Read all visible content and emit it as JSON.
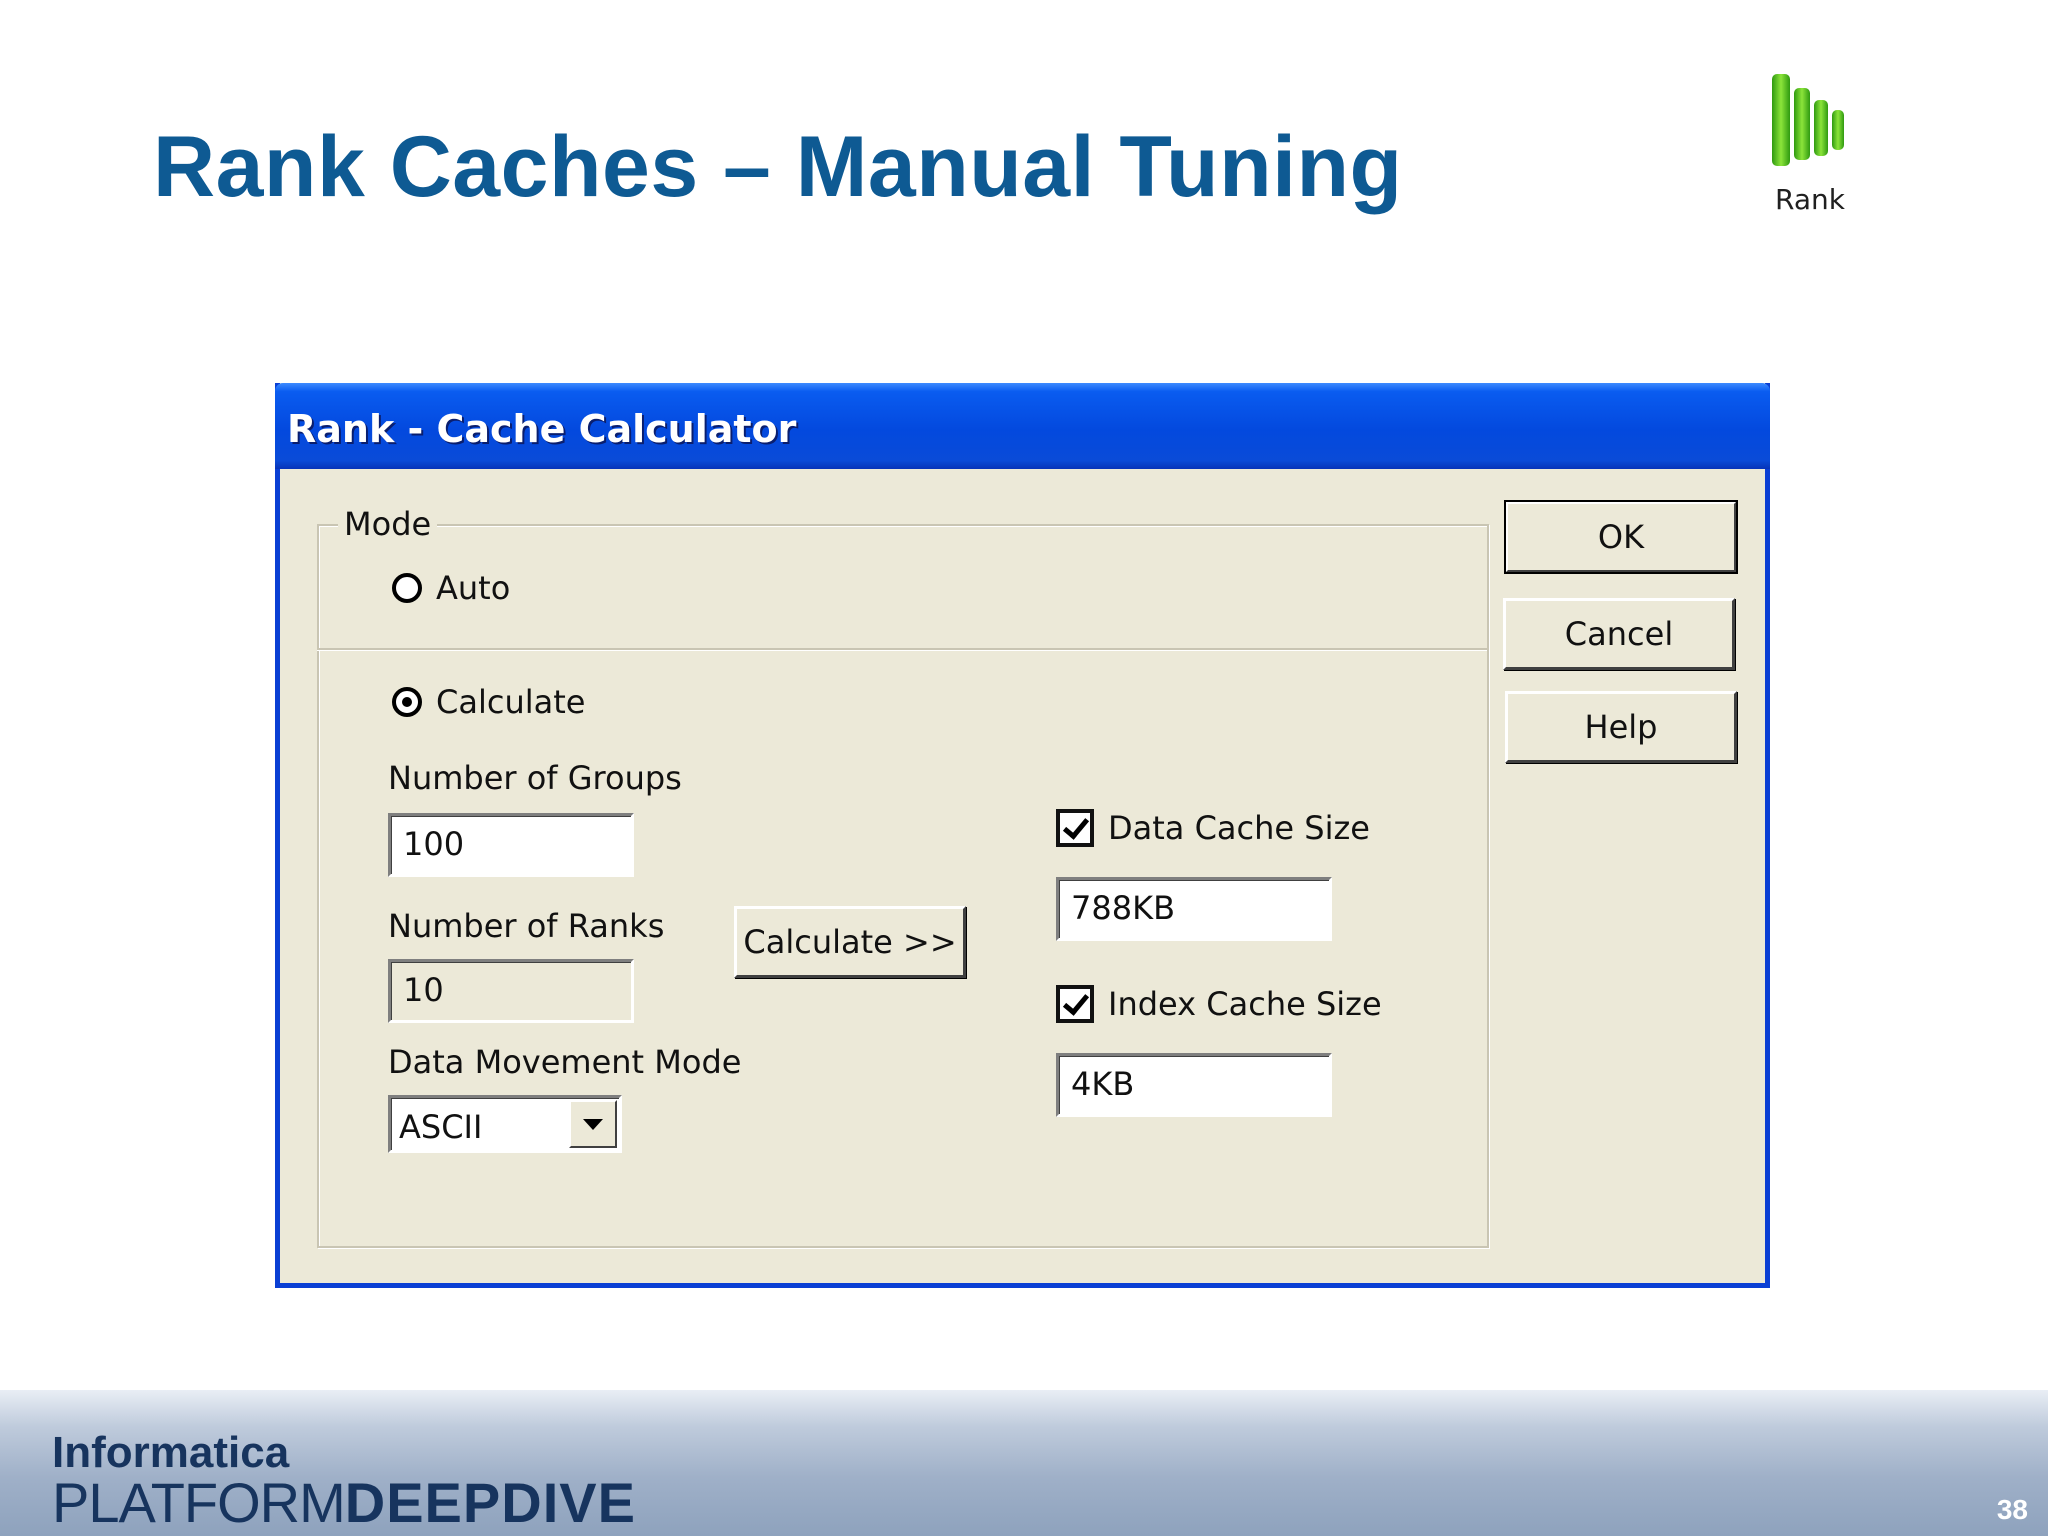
{
  "slide": {
    "title": "Rank Caches – Manual Tuning",
    "logo_label": "Rank",
    "page_number": "38"
  },
  "dialog": {
    "title": "Rank - Cache Calculator",
    "mode_legend": "Mode",
    "auto_label": "Auto",
    "calculate_label": "Calculate",
    "selected_mode": "Calculate",
    "groups_label": "Number of Groups",
    "groups_value": "100",
    "ranks_label": "Number of Ranks",
    "ranks_value": "10",
    "movement_label": "Data Movement Mode",
    "movement_value": "ASCII",
    "calculate_button": "Calculate >>",
    "data_cache_label": "Data Cache Size",
    "data_cache_checked": true,
    "data_cache_value": "788KB",
    "index_cache_label": "Index Cache Size",
    "index_cache_checked": true,
    "index_cache_value": "4KB",
    "ok_button": "OK",
    "cancel_button": "Cancel",
    "help_button": "Help"
  },
  "footer": {
    "brand_top": "Informatica",
    "brand_light": "PLATFORM",
    "brand_bold": "DEEPDIVE"
  },
  "colors": {
    "title_blue": "#0e5a93",
    "titlebar_blue": "#0349de",
    "dialog_face": "#ece9d8",
    "logo_green": "#4cc61e"
  },
  "icons": {
    "logo": "rank-bars-icon",
    "dropdown": "chevron-down-icon"
  }
}
